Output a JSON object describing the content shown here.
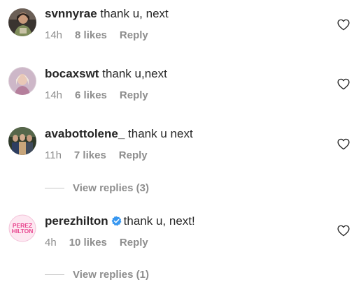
{
  "comments": [
    {
      "username": "svnnyrae",
      "text": "thank u, next",
      "time": "14h",
      "likes": "8 likes",
      "reply": "Reply",
      "verified": false
    },
    {
      "username": "bocaxswt",
      "text": "thank u,next",
      "time": "14h",
      "likes": "6 likes",
      "reply": "Reply",
      "verified": false
    },
    {
      "username": "avabottolene_",
      "text": "thank u next",
      "time": "11h",
      "likes": "7 likes",
      "reply": "Reply",
      "verified": false
    },
    {
      "username": "perezhilton",
      "text": "thank u, next!",
      "time": "4h",
      "likes": "10 likes",
      "reply": "Reply",
      "verified": true,
      "avatar_logo_text": [
        "PEREZ",
        "HILTON"
      ]
    }
  ],
  "view_replies": [
    {
      "label": "View replies (3)"
    },
    {
      "label": "View replies (1)"
    }
  ],
  "icons": {
    "like": "heart-outline-icon",
    "verified": "verified-badge-icon"
  },
  "colors": {
    "text": "#262626",
    "muted": "#8e8e8e",
    "verified": "#3897f0",
    "perez_pink": "#e8468f"
  }
}
